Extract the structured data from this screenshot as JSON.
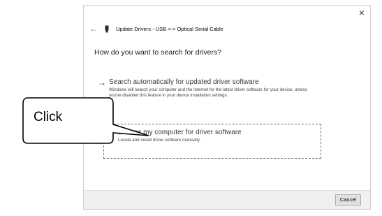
{
  "window": {
    "title": "Update Drivers - USB <-> Optical Serial Cable",
    "close_glyph": "×",
    "back_glyph": "←",
    "icons": [
      "back-arrow-icon",
      "usb-device-icon",
      "close-icon"
    ]
  },
  "question": "How do you want to search for drivers?",
  "options": [
    {
      "arrow": "→",
      "title": "Search automatically for updated driver software",
      "description": "Windows will search your computer and the Internet for the latest driver software for your device, unless you've disabled this feature in your device installation settings."
    },
    {
      "arrow": "→",
      "title": "Browse my computer for driver software",
      "description": "Locate and install driver software manually."
    }
  ],
  "footer": {
    "cancel_label": "Cancel"
  },
  "annotation": {
    "callout_text": "Click"
  },
  "colors": {
    "dialog_bg": "#ffffff",
    "footer_bg": "#f0f0f0",
    "selection_border": "#6e6e6e"
  }
}
